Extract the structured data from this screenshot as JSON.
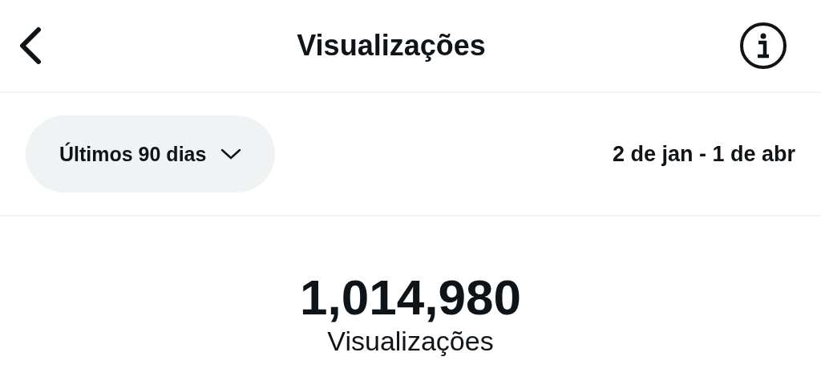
{
  "header": {
    "title": "Visualizações"
  },
  "filter": {
    "range": "Últimos 90 dias",
    "dates": "2 de jan - 1 de abr"
  },
  "metric": {
    "value": "1,014,980",
    "label": "Visualizações"
  }
}
